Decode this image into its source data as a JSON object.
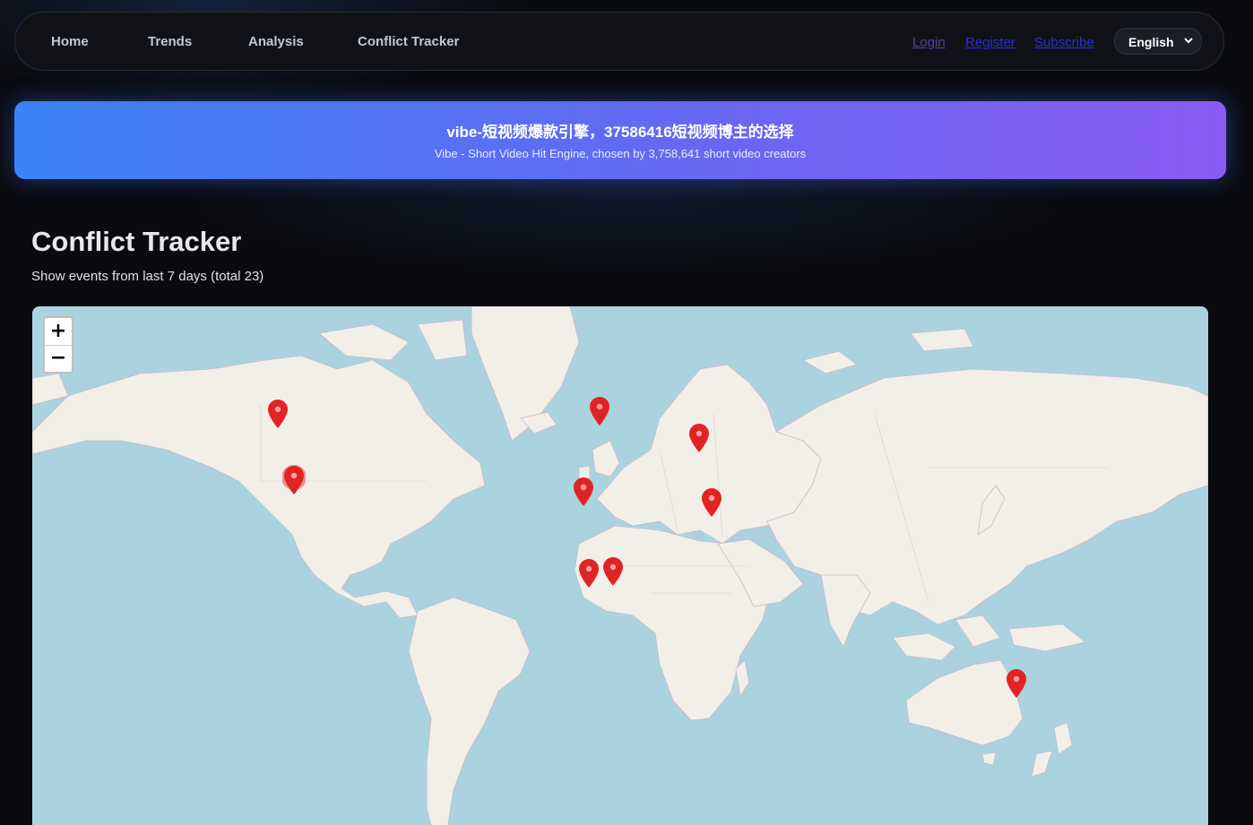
{
  "nav": {
    "links": [
      {
        "label": "Home",
        "name": "nav-home"
      },
      {
        "label": "Trends",
        "name": "nav-trends"
      },
      {
        "label": "Analysis",
        "name": "nav-analysis"
      },
      {
        "label": "Conflict Tracker",
        "name": "nav-conflict-tracker"
      }
    ],
    "login": "Login",
    "register": "Register",
    "subscribe": "Subscribe",
    "language": "English"
  },
  "banner": {
    "title": "vibe-短视频爆款引擎，37586416短视频博主的选择",
    "subtitle": "Vibe - Short Video Hit Engine, chosen by 3,758,641 short video creators"
  },
  "page": {
    "title": "Conflict Tracker",
    "subtitle": "Show events from last 7 days (total 23)"
  },
  "map": {
    "zoom_in": "+",
    "zoom_out": "−",
    "marker_color": "#e02424",
    "land_color": "#f2efe9",
    "water_color": "#aad3df",
    "markers": [
      {
        "name": "marker-canada",
        "lat": 52.0,
        "lon": -106.0
      },
      {
        "name": "marker-usa",
        "lat": 37.0,
        "lon": -101.0,
        "clustered": true
      },
      {
        "name": "marker-uk",
        "lat": 52.5,
        "lon": -1.5
      },
      {
        "name": "marker-ukraine",
        "lat": 47.0,
        "lon": 31.0
      },
      {
        "name": "marker-morocco",
        "lat": 34.0,
        "lon": -6.8
      },
      {
        "name": "marker-middle-east",
        "lat": 31.0,
        "lon": 35.0
      },
      {
        "name": "marker-west-africa-1",
        "lat": 10.0,
        "lon": -5.0
      },
      {
        "name": "marker-west-africa-2",
        "lat": 10.5,
        "lon": 3.0
      },
      {
        "name": "marker-australia",
        "lat": -24.5,
        "lon": 134.0
      }
    ]
  }
}
